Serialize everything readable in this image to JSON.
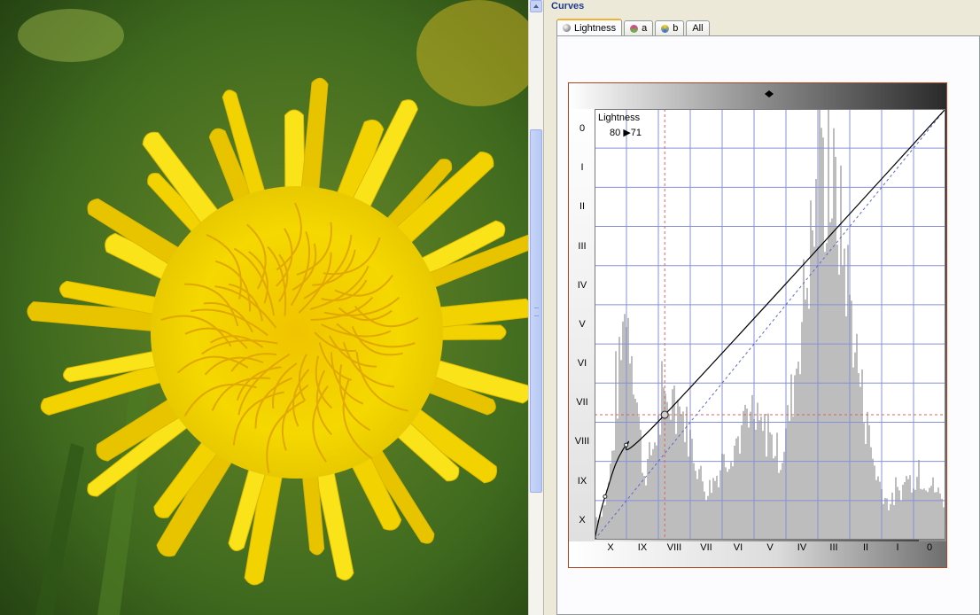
{
  "panel": {
    "title": "Curves"
  },
  "tabs": [
    {
      "label": "Lightness",
      "icon": "lightness-channel-icon",
      "active": true
    },
    {
      "label": "a",
      "icon": "a-channel-icon"
    },
    {
      "label": "b",
      "icon": "b-channel-icon"
    },
    {
      "label": "All",
      "icon": ""
    }
  ],
  "readout": {
    "channel": "Lightness",
    "input": "80",
    "output": "71"
  },
  "axes": {
    "y_ticks": [
      "0",
      "I",
      "II",
      "III",
      "IV",
      "V",
      "VI",
      "VII",
      "VIII",
      "IX",
      "X"
    ],
    "x_ticks": [
      "X",
      "IX",
      "VIII",
      "VII",
      "VI",
      "V",
      "IV",
      "III",
      "II",
      "I",
      "0"
    ]
  },
  "curve": {
    "control_points": [
      {
        "in": 0,
        "out": 0
      },
      {
        "in": 3,
        "out": 10
      },
      {
        "in": 9,
        "out": 22
      },
      {
        "in": 20,
        "out": 29
      },
      {
        "in": 100,
        "out": 100
      }
    ],
    "selected_point": {
      "in": 20,
      "out": 29
    }
  },
  "colors": {
    "frame_border": "#b3451c",
    "grid": "#8890d8",
    "histogram": "#bdbdbd",
    "guide": "#e06060",
    "tab_accent": "#f0b233"
  }
}
